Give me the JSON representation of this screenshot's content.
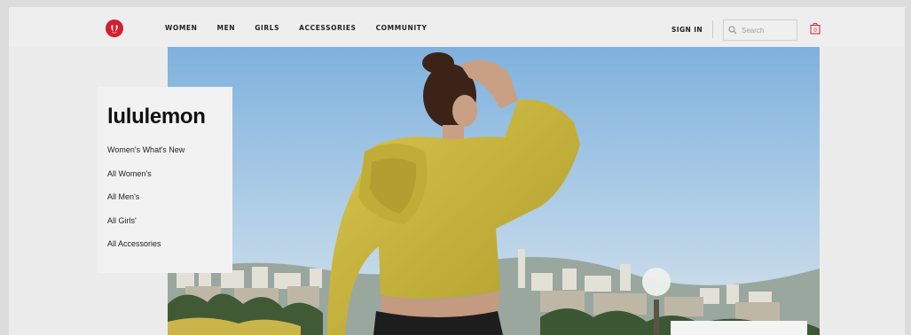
{
  "nav": {
    "links": [
      "WOMEN",
      "MEN",
      "GIRLS",
      "ACCESSORIES",
      "COMMUNITY"
    ],
    "sign_in": "SIGN IN",
    "search_placeholder": "Search"
  },
  "brand": {
    "name": "lululemon",
    "menu": [
      "Women's What's New",
      "All Women's",
      "All Men's",
      "All Girls'",
      "All Accessories"
    ]
  },
  "colors": {
    "logo": "#d31f2f",
    "sky": "#9ec3e6",
    "hoodie": "#c8b43c",
    "page_bg": "#ececec"
  },
  "icons": {
    "logo": "lululemon-logo-icon",
    "search": "search-icon",
    "bag": "shopping-bag-icon"
  }
}
